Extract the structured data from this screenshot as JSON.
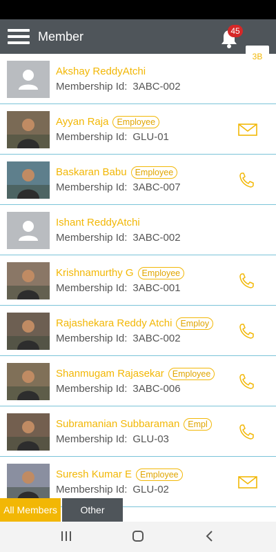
{
  "app": {
    "title": "Member",
    "notifications": "45",
    "user_initials": "3B"
  },
  "members": [
    {
      "name": "Akshay ReddyAtchi",
      "label": "Membership Id:",
      "id": "3ABC-002",
      "tag": "",
      "action": "none",
      "photo": "placeholder"
    },
    {
      "name": "Ayyan Raja",
      "label": "Membership Id:",
      "id": "GLU-01",
      "tag": "Employee",
      "action": "mail-icon",
      "photo": "photo"
    },
    {
      "name": "Baskaran Babu",
      "label": "Membership Id:",
      "id": "3ABC-007",
      "tag": "Employee",
      "action": "phone-icon",
      "photo": "photo"
    },
    {
      "name": "Ishant ReddyAtchi",
      "label": "Membership Id:",
      "id": "3ABC-002",
      "tag": "",
      "action": "none",
      "photo": "placeholder"
    },
    {
      "name": "Krishnamurthy G",
      "label": "Membership Id:",
      "id": "3ABC-001",
      "tag": "Employee",
      "action": "phone-icon",
      "photo": "photo"
    },
    {
      "name": "Rajashekara Reddy Atchi",
      "label": "Membership Id:",
      "id": "3ABC-002",
      "tag": "Employ",
      "action": "phone-icon",
      "photo": "photo"
    },
    {
      "name": "Shanmugam Rajasekar",
      "label": "Membership Id:",
      "id": "3ABC-006",
      "tag": "Employee",
      "action": "phone-icon",
      "photo": "photo"
    },
    {
      "name": "Subramanian Subbaraman",
      "label": "Membership Id:",
      "id": "GLU-03",
      "tag": "Empl",
      "action": "phone-icon",
      "photo": "photo"
    },
    {
      "name": "Suresh Kumar E",
      "label": "Membership Id:",
      "id": "GLU-02",
      "tag": "Employee",
      "action": "mail-icon",
      "photo": "photo"
    }
  ],
  "tabs": {
    "all": "All Members",
    "other": "Other"
  },
  "colors": {
    "accent": "#f2b705",
    "appbar": "#4f555a",
    "divider": "#79c3d8"
  }
}
